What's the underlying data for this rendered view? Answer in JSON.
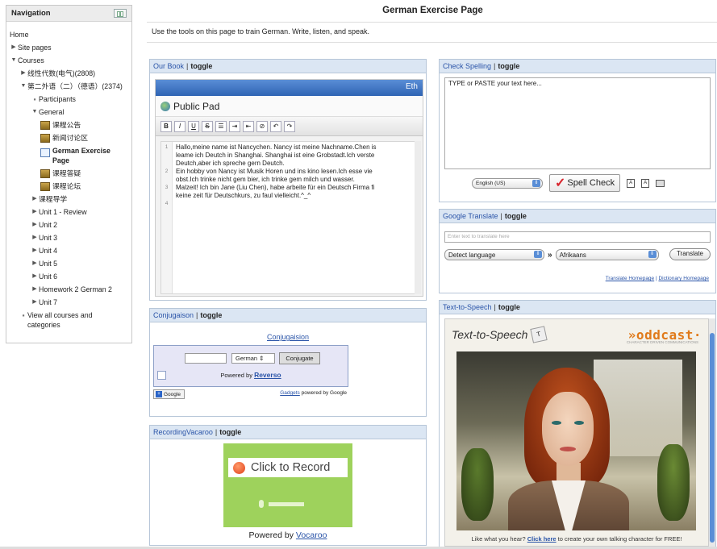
{
  "nav": {
    "title": "Navigation",
    "home": "Home",
    "site_pages": "Site pages",
    "courses": "Courses",
    "course1": "线性代数(电气)(2808)",
    "course2": "第二外语（二）（德语）(2374)",
    "participants": "Participants",
    "general": "General",
    "res1": "课程公告",
    "res2": "新闻讨论区",
    "res3": "German Exercise Page",
    "res4": "课程答疑",
    "res5": "课程论坛",
    "guide": "课程导学",
    "units": [
      "Unit 1 - Review",
      "Unit 2",
      "Unit 3",
      "Unit 4",
      "Unit 5",
      "Unit 6",
      "Homework 2 German 2",
      "Unit 7"
    ],
    "view_all": "View all courses and categories"
  },
  "page": {
    "title": "German Exercise Page",
    "intro": "Use the tools on this page to train German. Write, listen, and speak."
  },
  "toggle": "toggle",
  "ourbook": {
    "title": "Our Book",
    "eth": "Eth",
    "public_pad": "Public Pad",
    "lines": [
      "Hallo,meine name ist Nancychen. Nancy ist meine Nachname.Chen is",
      "leame ich Deutch in Shanghai. Shanghai ist eine Grobstadt.Ich verste",
      "Deutch,aber ich spreche gern Deutch.",
      "Ein hobby von Nancy ist Musik Horen und ins kino lesen.Ich esse vie",
      "obst.Ich trinke nicht gem bier, ich trinke gem milch und wasser.",
      "Malzeit! Ich bin Jane (Liu Chen), habe arbeite für ein Deutsch Firma fi",
      "keine zeit für Deutschkurs, zu faul vielleicht.^_^"
    ],
    "gutter": [
      "1",
      "",
      "",
      "2",
      "",
      "3",
      "",
      "4"
    ]
  },
  "spell": {
    "title": "Check Spelling",
    "placeholder": "TYPE or PASTE your text here...",
    "language": "English (US)",
    "button": "Spell Check"
  },
  "translate": {
    "title": "Google Translate",
    "placeholder": "Enter text to translate here",
    "from": "Detect language",
    "to": "Afrikaans",
    "button": "Translate",
    "link1": "Translate Homepage",
    "link2": "Dictionary Homepage"
  },
  "conj": {
    "title": "Conjugaison",
    "link": "Conjugaision",
    "language": "German",
    "button": "Conjugate",
    "powered": "Powered by",
    "reverso": "Reverso",
    "google_btn": "Google",
    "gadgets": "Gadgets",
    "gadgets_tail": "powered by Google"
  },
  "rec": {
    "title": "RecordingVacaroo",
    "click": "Click to Record",
    "powered": "Powered by",
    "vocaroo": "Vocaroo"
  },
  "tts": {
    "title": "Text-to-Speech",
    "brand_title": "Text-to-Speech",
    "oddcast": "»oddcast·",
    "oddcast_sub": "CHARACTER DRIVEN COMMUNICATIONS",
    "foot_pre": "Like what you hear?",
    "foot_link": "Click here",
    "foot_post": "to create your own talking character for FREE!"
  }
}
